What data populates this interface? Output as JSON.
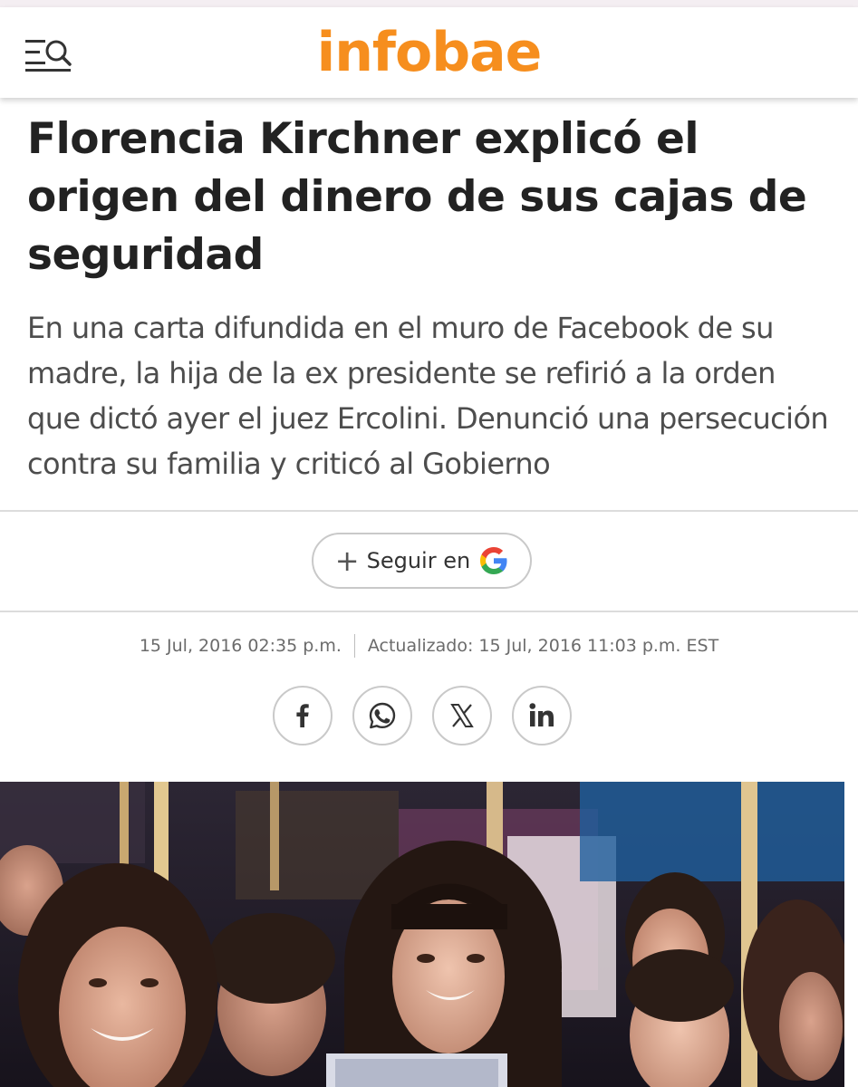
{
  "header": {
    "logo": "infobae",
    "brand_color": "#f68e1e",
    "menu_icon": "menu-search-icon"
  },
  "article": {
    "title": "Florencia Kirchner explicó el origen del dinero de sus cajas de seguridad",
    "subtitle": "En una carta difundida en el muro de Facebook de su madre, la hija de la ex presidente se refirió a la orden que dictó ayer el juez Ercolini. Denunció una persecución contra su familia y criticó al Gobierno",
    "published": "15 Jul, 2016 02:35 p.m.",
    "updated": "Actualizado: 15 Jul, 2016 11:03 p.m. EST"
  },
  "follow": {
    "label": "Seguir en",
    "icons": [
      "plus-icon",
      "google-icon"
    ]
  },
  "share": {
    "icons": [
      "facebook-icon",
      "whatsapp-icon",
      "x-icon",
      "linkedin-icon"
    ]
  },
  "photo": {
    "subject": "crowd-photo"
  }
}
